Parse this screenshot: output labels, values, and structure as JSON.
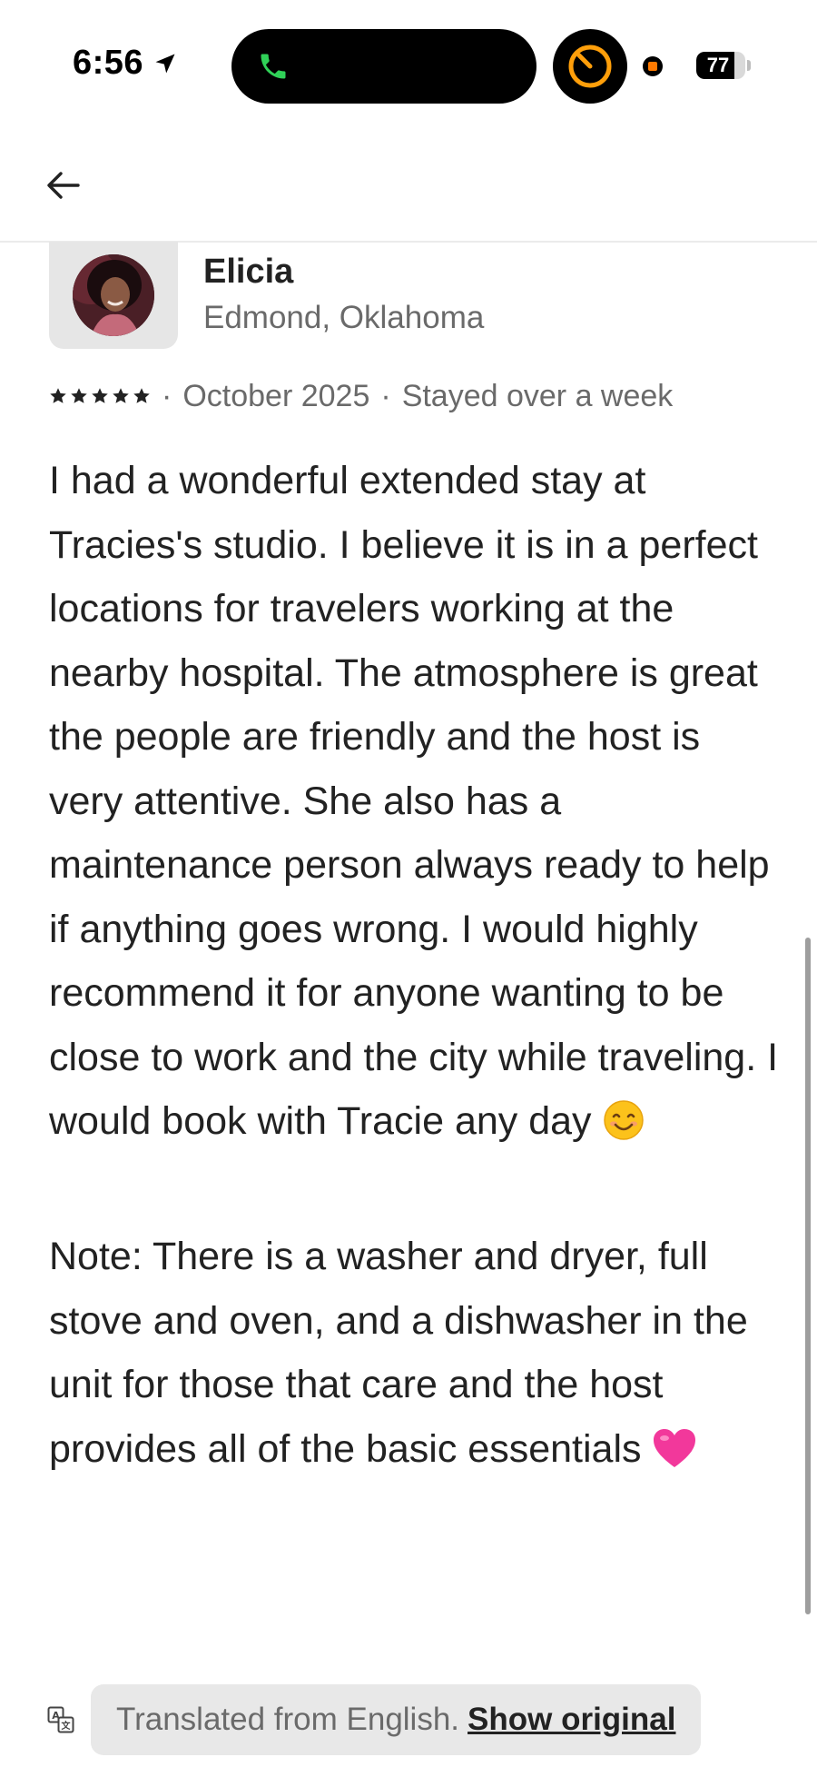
{
  "status_bar": {
    "time": "6:56",
    "battery_level": "77",
    "battery_fraction": 0.77,
    "icons": [
      "location-arrow-icon",
      "phone-call-icon",
      "timer-icon",
      "screen-record-icon",
      "battery-icon"
    ],
    "colors": {
      "call_green": "#30d158",
      "timer_orange": "#ff9f0a"
    }
  },
  "header": {
    "back_icon": "arrow-left-icon"
  },
  "review": {
    "reviewer_name": "Elicia",
    "reviewer_location": "Edmond, Oklahoma",
    "rating": 5,
    "date": "October 2025",
    "stay_length": "Stayed over a week",
    "separator": "·",
    "body_text": "I had a wonderful extended stay at Tracies's studio. I believe it is in a perfect locations for travelers working at the nearby hospital. The atmosphere is great the people are friendly and the host is very attentive. She also has a maintenance person always ready to help if anything goes wrong. I would highly recommend it for anyone wanting to be close to work and the city while traveling. I would book with Tracie any day ",
    "note_text": "Note: There is a washer and dryer, full stove and oven, and a dishwasher in the unit for those that care and the host provides all of the basic essentials ",
    "body_emoji": "smiling-face-emoji",
    "note_emoji": "pink-heart-emoji"
  },
  "translation": {
    "notice": "Translated from English.",
    "show_original": "Show original",
    "icon": "translate-icon"
  }
}
